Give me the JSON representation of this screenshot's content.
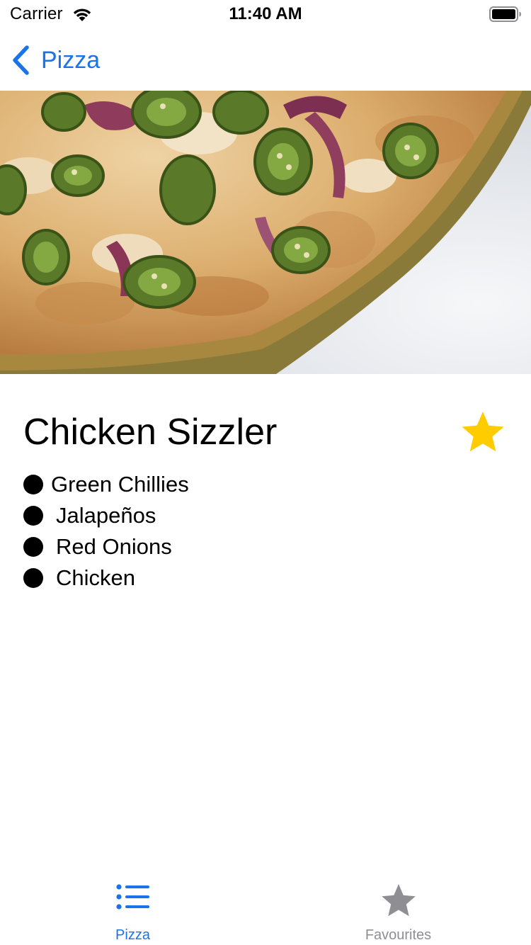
{
  "status_bar": {
    "carrier": "Carrier",
    "time": "11:40 AM",
    "wifi_icon": "wifi-icon",
    "battery_icon": "battery-icon"
  },
  "nav": {
    "back_label": "Pizza",
    "back_icon": "chevron-left-icon"
  },
  "hero": {
    "image": "pizza-photo"
  },
  "detail": {
    "title": "Chicken Sizzler",
    "favourite_icon": "star-icon",
    "ingredients": [
      {
        "label": "Green Chillies"
      },
      {
        "label": "Jalapeños"
      },
      {
        "label": "Red Onions"
      },
      {
        "label": "Chicken"
      }
    ]
  },
  "tab_bar": {
    "tabs": [
      {
        "label": "Pizza",
        "icon": "list-icon",
        "selected": true
      },
      {
        "label": "Favourites",
        "icon": "star-icon",
        "selected": false
      }
    ]
  },
  "colors": {
    "accent": "#1a73e8",
    "star": "#ffcc00",
    "inactive": "#8e8e93"
  }
}
